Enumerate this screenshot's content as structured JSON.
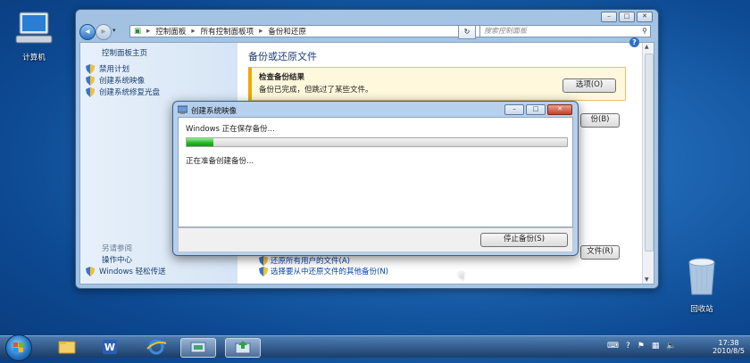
{
  "desktop": {
    "computer_label": "计算机",
    "recycle_label": "回收站"
  },
  "explorer": {
    "address_path": [
      "控制面板",
      "所有控制面板项",
      "备份和还原"
    ],
    "search_placeholder": "搜索控制面板",
    "left_pane": {
      "title": "控制面板主页",
      "items": [
        "禁用计划",
        "创建系统映像",
        "创建系统修复光盘"
      ],
      "see_also": "另请参阅",
      "see_also_items": [
        "操作中心",
        "Windows 轻松传送"
      ]
    },
    "heading": "备份或还原文件",
    "alert": {
      "title": "检查备份结果",
      "message": "备份已完成，但跳过了某些文件。",
      "options_button": "选项(O)"
    },
    "backup_button_partial": "份(B)",
    "restore_button_partial": "文件(R)",
    "links": [
      "还原所有用户的文件(A)",
      "选择要从中还原文件的其他备份(N)"
    ]
  },
  "dialog": {
    "title": "创建系统映像",
    "status": "Windows 正在保存备份...",
    "progress_fraction": 0.07,
    "detail": "正在准备创建备份...",
    "stop_button": "停止备份(S)"
  },
  "taskbar": {
    "time": "17:38",
    "date": "2010/8/5"
  }
}
